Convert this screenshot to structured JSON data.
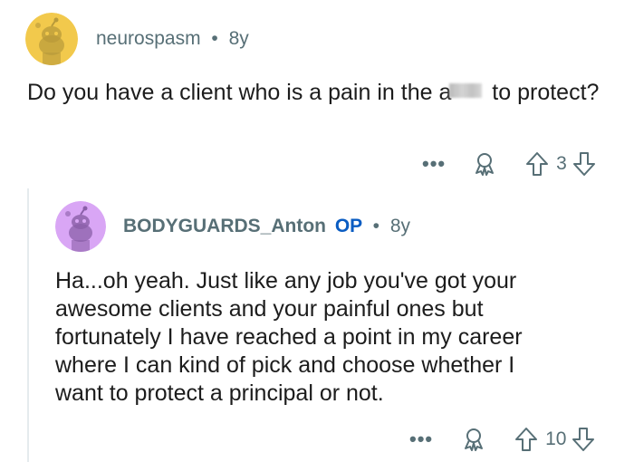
{
  "comments": [
    {
      "username": "neurospasm",
      "separator": "•",
      "age": "8y",
      "text_before": "Do you have a client who is a pain in the a",
      "text_after": " to protect?",
      "more_label": "•••",
      "vote_count": "3",
      "avatar_color": "#f2c94c"
    },
    {
      "username": "BODYGUARDS_Anton",
      "op_badge": "OP",
      "separator": "•",
      "age": "8y",
      "text_lines": [
        "Ha...oh yeah.  Just like any job you've got your",
        "awesome clients and your painful ones but",
        "fortunately I have reached a point in my career",
        "where I can kind of pick and choose whether I",
        "want to protect a principal or not."
      ],
      "more_label": "•••",
      "vote_count": "10",
      "avatar_color": "#d9a6f5"
    }
  ]
}
